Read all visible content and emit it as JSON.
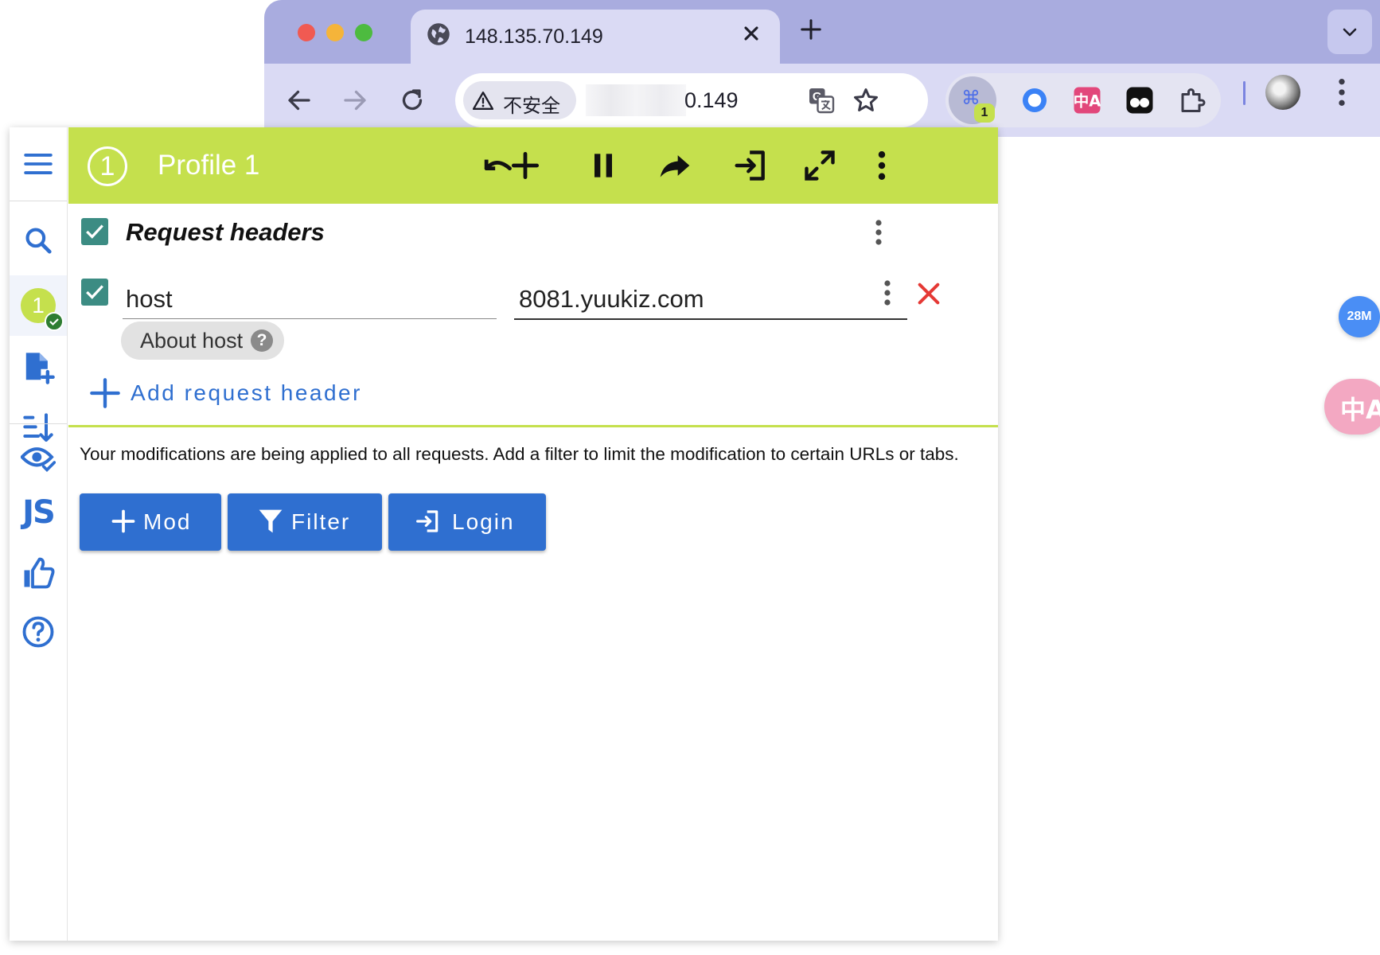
{
  "browser": {
    "tab_title": "148.135.70.149",
    "security_label": "不安全",
    "url_suffix": "0.149",
    "extension_badge": "1",
    "extension_cmd_glyph": "⌘",
    "icons": [
      "globe-icon",
      "close-icon",
      "plus-icon",
      "chevron-down-icon",
      "back-arrow-icon",
      "forward-arrow-icon",
      "reload-icon",
      "warning-icon",
      "translate-icon",
      "star-icon",
      "puzzle-icon",
      "kebab-menu-icon"
    ]
  },
  "popup": {
    "profile_number": "1",
    "profile_title": "Profile 1",
    "accent_color": "#c5e04d",
    "primary_color": "#2f6fd0",
    "sidebar_js_label": "JS",
    "section": {
      "title": "Request headers",
      "enabled": true
    },
    "header_row": {
      "name": "host",
      "value": "8081.yuukiz.com",
      "enabled": true
    },
    "about_chip": {
      "label": "About host",
      "help_glyph": "?"
    },
    "add_header_label": "Add request header",
    "info_text": "Your modifications are being applied to all requests. Add a filter to limit the modification to certain URLs or tabs.",
    "actions": {
      "mod": "Mod",
      "filter": "Filter",
      "login": "Login"
    }
  },
  "floating": {
    "memory_badge": "28M",
    "translate_glyph": "中A"
  }
}
